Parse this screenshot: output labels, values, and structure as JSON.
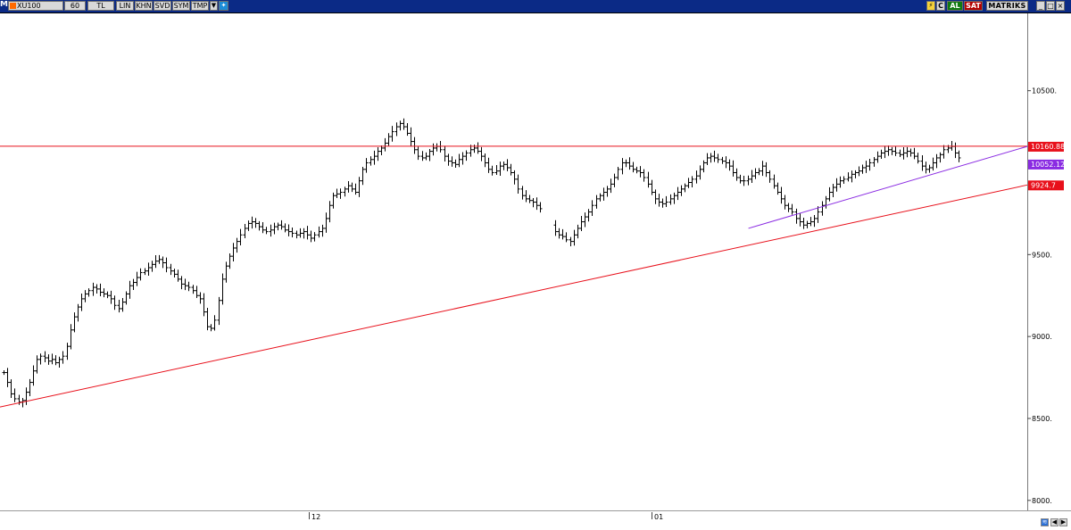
{
  "toolbar": {
    "m_label": "M",
    "symbol": "XU100",
    "period": "60",
    "currency": "TL",
    "buttons": [
      "LIN",
      "KHN",
      "SVD",
      "SYM",
      "TMP"
    ],
    "right_icons": [
      "lightning-icon",
      "c-icon"
    ],
    "buy_label": "AL",
    "sell_label": "SAT",
    "brand": "MATRIKS",
    "window_buttons": [
      "_",
      "□",
      "×"
    ],
    "colors": {
      "bar": "#0b2a86",
      "buy": "#0f7a0f",
      "sell": "#b30000"
    }
  },
  "price_tags": [
    {
      "label": "10160.88",
      "color": "#e8101b"
    },
    {
      "label": "10052.12",
      "color": "#8a2be2"
    },
    {
      "label": "9924.7",
      "color": "#e8101b"
    }
  ],
  "x_axis_labels": [
    "12",
    "01"
  ],
  "chart_data": {
    "type": "ohlc",
    "y_ticks": [
      "10500.",
      "9500.",
      "9000.",
      "8500.",
      "8000."
    ],
    "ylim": [
      7950,
      10950
    ],
    "grid": false,
    "lines": [
      {
        "name": "horizontal",
        "color": "#e8101b",
        "from": [
          0,
          10160.88
        ],
        "to": [
          1,
          10160.88
        ]
      },
      {
        "name": "support",
        "color": "#e8101b",
        "from": [
          0,
          8570
        ],
        "to": [
          1,
          9924.7
        ]
      },
      {
        "name": "short-trend",
        "color": "#8a2be2",
        "from": [
          0.73,
          9660
        ],
        "to": [
          1,
          10160
        ]
      }
    ],
    "closes": [
      8780,
      8720,
      8650,
      8620,
      8600,
      8610,
      8660,
      8720,
      8790,
      8860,
      8880,
      8870,
      8850,
      8860,
      8840,
      8860,
      8880,
      8940,
      9040,
      9120,
      9180,
      9230,
      9260,
      9280,
      9300,
      9290,
      9270,
      9260,
      9250,
      9230,
      9190,
      9170,
      9210,
      9260,
      9310,
      9330,
      9360,
      9390,
      9400,
      9420,
      9440,
      9460,
      9470,
      9450,
      9420,
      9400,
      9380,
      9350,
      9320,
      9310,
      9300,
      9280,
      9250,
      9230,
      9150,
      9060,
      9050,
      9100,
      9220,
      9350,
      9430,
      9490,
      9540,
      9580,
      9620,
      9660,
      9690,
      9700,
      9690,
      9670,
      9650,
      9640,
      9650,
      9670,
      9680,
      9670,
      9650,
      9640,
      9630,
      9620,
      9630,
      9640,
      9620,
      9600,
      9620,
      9640,
      9660,
      9720,
      9800,
      9860,
      9870,
      9880,
      9900,
      9920,
      9900,
      9880,
      9950,
      10020,
      10060,
      10080,
      10100,
      10130,
      10150,
      10180,
      10220,
      10250,
      10280,
      10300,
      10280,
      10240,
      10190,
      10140,
      10100,
      10090,
      10100,
      10130,
      10150,
      10160,
      10140,
      10100,
      10070,
      10060,
      10050,
      10080,
      10100,
      10120,
      10140,
      10150,
      10130,
      10100,
      10060,
      10020,
      10000,
      10010,
      10040,
      10050,
      10030,
      10000,
      9960,
      9900,
      9860,
      9840,
      9830,
      9820,
      9800,
      9780,
      9760,
      9720,
      9680,
      9640,
      9620,
      9610,
      9590,
      9580,
      9620,
      9660,
      9700,
      9730,
      9760,
      9800,
      9840,
      9860,
      9880,
      9900,
      9930,
      9970,
      10020,
      10060,
      10060,
      10040,
      10020,
      10010,
      10000,
      9970,
      9930,
      9880,
      9840,
      9820,
      9810,
      9820,
      9840,
      9860,
      9880,
      9900,
      9920,
      9940,
      9960,
      9980,
      10020,
      10060,
      10090,
      10100,
      10090,
      10080,
      10070,
      10060,
      10040,
      10000,
      9970,
      9950,
      9950,
      9960,
      9980,
      10000,
      10010,
      10040,
      10000,
      9960,
      9920,
      9880,
      9840,
      9800,
      9780,
      9760,
      9720,
      9700,
      9680,
      9690,
      9700,
      9720,
      9760,
      9800,
      9840,
      9880,
      9910,
      9930,
      9950,
      9960,
      9970,
      9990,
      10000,
      10010,
      10030,
      10040,
      10060,
      10080,
      10100,
      10120,
      10130,
      10140,
      10130,
      10120,
      10110,
      10120,
      10130,
      10120,
      10100,
      10070,
      10040,
      10020,
      10030,
      10060,
      10090,
      10110,
      10140,
      10150,
      10160,
      10120,
      10090
    ]
  }
}
